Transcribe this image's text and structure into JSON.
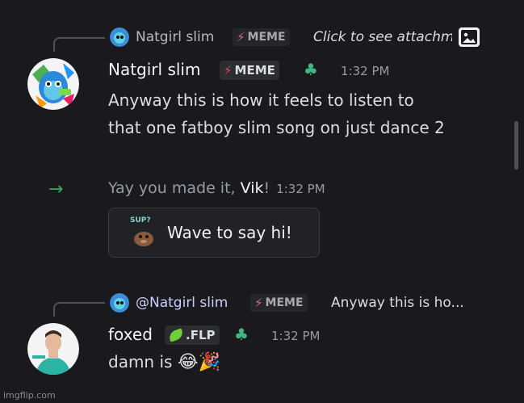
{
  "reply1": {
    "author": "Natgirl slim",
    "badge": "MEME",
    "preview": "Click to see attachment",
    "attachment_icon": "image-icon"
  },
  "message1": {
    "author": "Natgirl slim",
    "badge": "MEME",
    "time": "1:32 PM",
    "line1": "Anyway this is how it feels to listen to",
    "line2": "that one fatboy slim song on just dance 2"
  },
  "join": {
    "arrow_icon": "arrow-right-icon",
    "prefix": "Yay you made it, ",
    "user": "Vik",
    "suffix": "!",
    "time": "1:32 PM",
    "wave_sticker_text": "SUP?",
    "wave_label": "Wave to say hi!"
  },
  "reply2": {
    "author": "@Natgirl slim",
    "badge": "MEME",
    "preview": "Anyway this is ho..."
  },
  "message2": {
    "author": "foxed",
    "badge": ".FLP",
    "time": "1:32 PM",
    "text": "damn is",
    "emoji1": "😂",
    "emoji2": "🎉"
  },
  "watermark": "imgflip.com",
  "colors": {
    "background": "#1a1a1e",
    "meme_bolt": "#e0495c",
    "clover": "#43b581",
    "join_arrow": "#3ba55c"
  }
}
